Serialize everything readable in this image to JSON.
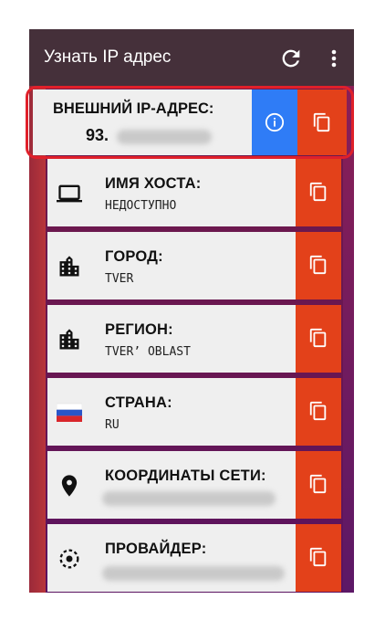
{
  "appbar": {
    "title": "Узнать IP адрес"
  },
  "ip": {
    "label": "ВНЕШНИЙ IP-АДРЕС:",
    "value": "93."
  },
  "items": [
    {
      "label": "ИМЯ ХОСТА:",
      "value": "НЕДОСТУПНО",
      "icon": "laptop-icon"
    },
    {
      "label": "ГОРОД:",
      "value": "TVER",
      "icon": "city-icon"
    },
    {
      "label": "РЕГИОН:",
      "value": "TVER’ OBLAST",
      "icon": "city-icon"
    },
    {
      "label": "СТРАНА:",
      "value": "RU",
      "icon": "russia-flag-icon"
    },
    {
      "label": "КООРДИНАТЫ СЕТИ:",
      "value": "",
      "icon": "location-pin-icon"
    },
    {
      "label": "ПРОВАЙДЕР:",
      "value": "",
      "icon": "gps-target-icon"
    }
  ],
  "colors": {
    "appbar": "#45303a",
    "copy": "#e3411a",
    "info": "#2f7cf6",
    "highlight": "#e0202a"
  }
}
